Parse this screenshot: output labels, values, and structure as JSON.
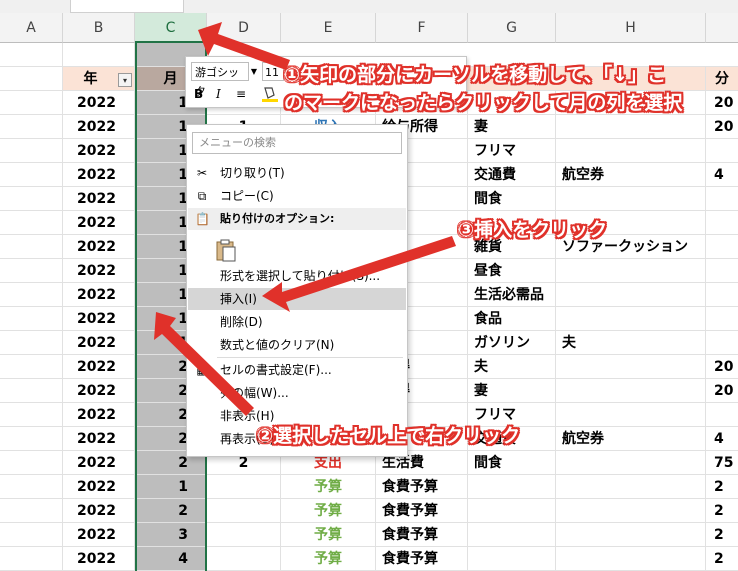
{
  "columns": [
    {
      "id": "A",
      "label": "A"
    },
    {
      "id": "B",
      "label": "B"
    },
    {
      "id": "C",
      "label": "C"
    },
    {
      "id": "D",
      "label": "D"
    },
    {
      "id": "E",
      "label": "E"
    },
    {
      "id": "F",
      "label": "F"
    },
    {
      "id": "G",
      "label": "G"
    },
    {
      "id": "H",
      "label": "H"
    }
  ],
  "header_row": {
    "year": "年",
    "month": "月",
    "f_partial": "分"
  },
  "filter_glyph": "▾",
  "rows": [
    {
      "b": "2022",
      "c": "1",
      "d": "",
      "e": "",
      "f": "",
      "g": "",
      "h": "",
      "i": "20"
    },
    {
      "b": "2022",
      "c": "1",
      "d": "1",
      "e": "収入",
      "f": "給与所得",
      "g": "妻",
      "h": "",
      "i": "20"
    },
    {
      "b": "2022",
      "c": "1",
      "d": "",
      "e": "",
      "f": "得",
      "g": "フリマ",
      "h": "",
      "i": ""
    },
    {
      "b": "2022",
      "c": "1",
      "d": "",
      "e": "",
      "f": "",
      "g": "交通費",
      "h": "航空券",
      "i": "4"
    },
    {
      "b": "2022",
      "c": "1",
      "d": "",
      "e": "",
      "f": "",
      "g": "間食",
      "h": "",
      "i": ""
    },
    {
      "b": "2022",
      "c": "1",
      "d": "",
      "e": "",
      "f": "",
      "g": "",
      "h": "",
      "i": ""
    },
    {
      "b": "2022",
      "c": "1",
      "d": "",
      "e": "",
      "f": "品",
      "g": "雑貨",
      "h": "ソファークッション",
      "i": ""
    },
    {
      "b": "2022",
      "c": "1",
      "d": "",
      "e": "",
      "f": "",
      "g": "昼食",
      "h": "",
      "i": ""
    },
    {
      "b": "2022",
      "c": "1",
      "d": "",
      "e": "",
      "f": "品",
      "g": "生活必需品",
      "h": "",
      "i": ""
    },
    {
      "b": "2022",
      "c": "1",
      "d": "",
      "e": "",
      "f": "",
      "g": "食品",
      "h": "",
      "i": ""
    },
    {
      "b": "2022",
      "c": "1",
      "d": "",
      "e": "",
      "f": "係",
      "g": "ガソリン",
      "h": "夫",
      "i": ""
    },
    {
      "b": "2022",
      "c": "2",
      "d": "",
      "e": "",
      "f": "所得",
      "g": "夫",
      "h": "",
      "i": "20"
    },
    {
      "b": "2022",
      "c": "2",
      "d": "",
      "e": "",
      "f": "所得",
      "g": "妻",
      "h": "",
      "i": "20"
    },
    {
      "b": "2022",
      "c": "2",
      "d": "",
      "e": "",
      "f": "得",
      "g": "フリマ",
      "h": "",
      "i": ""
    },
    {
      "b": "2022",
      "c": "2",
      "d": "",
      "e": "",
      "f": "",
      "g": "交通費",
      "h": "航空券",
      "i": "4"
    },
    {
      "b": "2022",
      "c": "2",
      "d": "2",
      "e": "支出",
      "f": "生活費",
      "g": "間食",
      "h": "",
      "i": "75"
    },
    {
      "b": "2022",
      "c": "1",
      "d": "",
      "e": "予算",
      "f": "食費予算",
      "g": "",
      "h": "",
      "i": "2"
    },
    {
      "b": "2022",
      "c": "2",
      "d": "",
      "e": "予算",
      "f": "食費予算",
      "g": "",
      "h": "",
      "i": "2"
    },
    {
      "b": "2022",
      "c": "3",
      "d": "",
      "e": "予算",
      "f": "食費予算",
      "g": "",
      "h": "",
      "i": "2"
    },
    {
      "b": "2022",
      "c": "4",
      "d": "",
      "e": "予算",
      "f": "食費予算",
      "g": "",
      "h": "",
      "i": "2"
    }
  ],
  "mini_toolbar": {
    "font": "游ゴシック",
    "size": "11",
    "bold": "B",
    "italic": "I",
    "align": "≡"
  },
  "context_menu": {
    "search_placeholder": "メニューの検索",
    "cut": "切り取り(T)",
    "copy": "コピー(C)",
    "paste_options": "貼り付けのオプション:",
    "paste_special": "形式を選択して貼り付け(S)...",
    "insert": "挿入(I)",
    "delete": "削除(D)",
    "clear": "数式と値のクリア(N)",
    "format_cells": "セルの書式設定(F)...",
    "col_width": "列の幅(W)...",
    "hide": "非表示(H)",
    "unhide": "再表示(U)"
  },
  "annotations": {
    "step1_line1": "①矢印の部分にカーソルを移動して、「↓」こ",
    "step1_line2": "のマークになったらクリックして月の列を選択",
    "step2": "②選択したセル上で右クリック",
    "step3": "③挿入をクリック"
  },
  "colors": {
    "selection": "#217346",
    "accent_red": "#e0312a",
    "income_blue": "#2e75b6",
    "expense_red": "#e0312a",
    "budget_green": "#70ad47",
    "header_fill": "#fbe3d6",
    "selected_col_fill": "#bdbdbd"
  }
}
